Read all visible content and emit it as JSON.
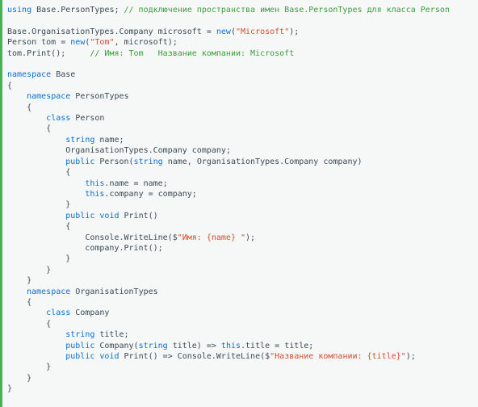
{
  "lines": [
    [
      {
        "cls": "kw",
        "t": "using"
      },
      {
        "cls": "plain",
        "t": " Base.PersonTypes; "
      },
      {
        "cls": "cmt",
        "t": "// подключение пространства имен Base.PersonTypes для класса Person"
      }
    ],
    [],
    [
      {
        "cls": "plain",
        "t": "Base.OrganisationTypes.Company microsoft = "
      },
      {
        "cls": "kw",
        "t": "new"
      },
      {
        "cls": "plain",
        "t": "("
      },
      {
        "cls": "str",
        "t": "\"Microsoft\""
      },
      {
        "cls": "plain",
        "t": ");"
      }
    ],
    [
      {
        "cls": "plain",
        "t": "Person tom = "
      },
      {
        "cls": "kw",
        "t": "new"
      },
      {
        "cls": "plain",
        "t": "("
      },
      {
        "cls": "str",
        "t": "\"Tom\""
      },
      {
        "cls": "plain",
        "t": ", microsoft);"
      }
    ],
    [
      {
        "cls": "plain",
        "t": "tom.Print();     "
      },
      {
        "cls": "cmt",
        "t": "// Имя: Tom   Название компании: Microsoft"
      }
    ],
    [],
    [
      {
        "cls": "kw",
        "t": "namespace"
      },
      {
        "cls": "plain",
        "t": " Base"
      }
    ],
    [
      {
        "cls": "plain",
        "t": "{"
      }
    ],
    [
      {
        "cls": "plain",
        "t": "    "
      },
      {
        "cls": "kw",
        "t": "namespace"
      },
      {
        "cls": "plain",
        "t": " PersonTypes"
      }
    ],
    [
      {
        "cls": "plain",
        "t": "    {"
      }
    ],
    [
      {
        "cls": "plain",
        "t": "        "
      },
      {
        "cls": "kw",
        "t": "class"
      },
      {
        "cls": "plain",
        "t": " Person"
      }
    ],
    [
      {
        "cls": "plain",
        "t": "        {"
      }
    ],
    [
      {
        "cls": "plain",
        "t": "            "
      },
      {
        "cls": "kw",
        "t": "string"
      },
      {
        "cls": "plain",
        "t": " name;"
      }
    ],
    [
      {
        "cls": "plain",
        "t": "            OrganisationTypes.Company company;"
      }
    ],
    [
      {
        "cls": "plain",
        "t": "            "
      },
      {
        "cls": "kw",
        "t": "public"
      },
      {
        "cls": "plain",
        "t": " Person("
      },
      {
        "cls": "kw",
        "t": "string"
      },
      {
        "cls": "plain",
        "t": " name, OrganisationTypes.Company company)"
      }
    ],
    [
      {
        "cls": "plain",
        "t": "            {"
      }
    ],
    [
      {
        "cls": "plain",
        "t": "                "
      },
      {
        "cls": "kw",
        "t": "this"
      },
      {
        "cls": "plain",
        "t": ".name = name;"
      }
    ],
    [
      {
        "cls": "plain",
        "t": "                "
      },
      {
        "cls": "kw",
        "t": "this"
      },
      {
        "cls": "plain",
        "t": ".company = company;"
      }
    ],
    [
      {
        "cls": "plain",
        "t": "            }"
      }
    ],
    [
      {
        "cls": "plain",
        "t": "            "
      },
      {
        "cls": "kw",
        "t": "public"
      },
      {
        "cls": "plain",
        "t": " "
      },
      {
        "cls": "kw",
        "t": "void"
      },
      {
        "cls": "plain",
        "t": " Print()"
      }
    ],
    [
      {
        "cls": "plain",
        "t": "            {"
      }
    ],
    [
      {
        "cls": "plain",
        "t": "                Console.WriteLine($"
      },
      {
        "cls": "str",
        "t": "\"Имя: {name} \""
      },
      {
        "cls": "plain",
        "t": ");"
      }
    ],
    [
      {
        "cls": "plain",
        "t": "                company.Print();"
      }
    ],
    [
      {
        "cls": "plain",
        "t": "            }"
      }
    ],
    [
      {
        "cls": "plain",
        "t": "        }"
      }
    ],
    [
      {
        "cls": "plain",
        "t": "    }"
      }
    ],
    [
      {
        "cls": "plain",
        "t": "    "
      },
      {
        "cls": "kw",
        "t": "namespace"
      },
      {
        "cls": "plain",
        "t": " OrganisationTypes"
      }
    ],
    [
      {
        "cls": "plain",
        "t": "    {"
      }
    ],
    [
      {
        "cls": "plain",
        "t": "        "
      },
      {
        "cls": "kw",
        "t": "class"
      },
      {
        "cls": "plain",
        "t": " Company"
      }
    ],
    [
      {
        "cls": "plain",
        "t": "        {"
      }
    ],
    [
      {
        "cls": "plain",
        "t": "            "
      },
      {
        "cls": "kw",
        "t": "string"
      },
      {
        "cls": "plain",
        "t": " title;"
      }
    ],
    [
      {
        "cls": "plain",
        "t": "            "
      },
      {
        "cls": "kw",
        "t": "public"
      },
      {
        "cls": "plain",
        "t": " Company("
      },
      {
        "cls": "kw",
        "t": "string"
      },
      {
        "cls": "plain",
        "t": " title) => "
      },
      {
        "cls": "kw",
        "t": "this"
      },
      {
        "cls": "plain",
        "t": ".title = title;"
      }
    ],
    [
      {
        "cls": "plain",
        "t": "            "
      },
      {
        "cls": "kw",
        "t": "public"
      },
      {
        "cls": "plain",
        "t": " "
      },
      {
        "cls": "kw",
        "t": "void"
      },
      {
        "cls": "plain",
        "t": " Print() => Console.WriteLine($"
      },
      {
        "cls": "str",
        "t": "\"Название компании: {title}\""
      },
      {
        "cls": "plain",
        "t": ");"
      }
    ],
    [
      {
        "cls": "plain",
        "t": "        }"
      }
    ],
    [
      {
        "cls": "plain",
        "t": "    }"
      }
    ],
    [
      {
        "cls": "plain",
        "t": "}"
      }
    ]
  ]
}
